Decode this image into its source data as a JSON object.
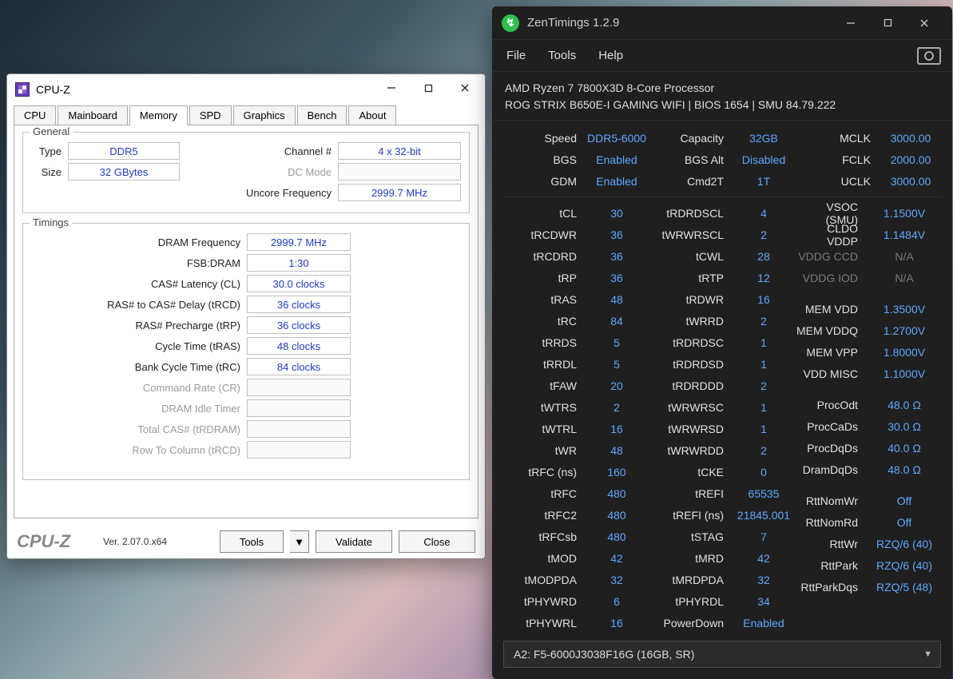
{
  "cpuz": {
    "title": "CPU-Z",
    "tabs": [
      "CPU",
      "Mainboard",
      "Memory",
      "SPD",
      "Graphics",
      "Bench",
      "About"
    ],
    "active_tab": "Memory",
    "general_legend": "General",
    "timings_legend": "Timings",
    "general": {
      "type_label": "Type",
      "type": "DDR5",
      "size_label": "Size",
      "size": "32 GBytes",
      "channel_label": "Channel #",
      "channel": "4 x 32-bit",
      "dcmode_label": "DC Mode",
      "dcmode": "",
      "uncore_label": "Uncore Frequency",
      "uncore": "2999.7 MHz"
    },
    "timings": [
      {
        "label": "DRAM Frequency",
        "value": "2999.7 MHz"
      },
      {
        "label": "FSB:DRAM",
        "value": "1:30"
      },
      {
        "label": "CAS# Latency (CL)",
        "value": "30.0 clocks"
      },
      {
        "label": "RAS# to CAS# Delay (tRCD)",
        "value": "36 clocks"
      },
      {
        "label": "RAS# Precharge (tRP)",
        "value": "36 clocks"
      },
      {
        "label": "Cycle Time (tRAS)",
        "value": "48 clocks"
      },
      {
        "label": "Bank Cycle Time (tRC)",
        "value": "84 clocks"
      },
      {
        "label": "Command Rate (CR)",
        "value": ""
      },
      {
        "label": "DRAM Idle Timer",
        "value": ""
      },
      {
        "label": "Total CAS# (tRDRAM)",
        "value": ""
      },
      {
        "label": "Row To Column (tRCD)",
        "value": ""
      }
    ],
    "footer": {
      "logo": "CPU-Z",
      "version": "Ver. 2.07.0.x64",
      "tools": "Tools",
      "validate": "Validate",
      "close": "Close"
    }
  },
  "zt": {
    "title": "ZenTimings 1.2.9",
    "menu": [
      "File",
      "Tools",
      "Help"
    ],
    "cpu": "AMD Ryzen 7 7800X3D 8-Core Processor",
    "board": "ROG STRIX B650E-I GAMING WIFI | BIOS 1654 | SMU 84.79.222",
    "top": {
      "col1": [
        {
          "k": "Speed",
          "v": "DDR5-6000"
        },
        {
          "k": "BGS",
          "v": "Enabled"
        },
        {
          "k": "GDM",
          "v": "Enabled"
        }
      ],
      "col2": [
        {
          "k": "Capacity",
          "v": "32GB"
        },
        {
          "k": "BGS Alt",
          "v": "Disabled"
        },
        {
          "k": "Cmd2T",
          "v": "1T"
        }
      ],
      "col3": [
        {
          "k": "MCLK",
          "v": "3000.00"
        },
        {
          "k": "FCLK",
          "v": "2000.00"
        },
        {
          "k": "UCLK",
          "v": "3000.00"
        }
      ]
    },
    "col1": [
      {
        "k": "tCL",
        "v": "30"
      },
      {
        "k": "tRCDWR",
        "v": "36"
      },
      {
        "k": "tRCDRD",
        "v": "36"
      },
      {
        "k": "tRP",
        "v": "36"
      },
      {
        "k": "tRAS",
        "v": "48"
      },
      {
        "k": "tRC",
        "v": "84"
      },
      {
        "k": "tRRDS",
        "v": "5"
      },
      {
        "k": "tRRDL",
        "v": "5"
      },
      {
        "k": "tFAW",
        "v": "20"
      },
      {
        "k": "tWTRS",
        "v": "2"
      },
      {
        "k": "tWTRL",
        "v": "16"
      },
      {
        "k": "tWR",
        "v": "48"
      },
      {
        "k": "tRFC (ns)",
        "v": "160"
      },
      {
        "k": "tRFC",
        "v": "480"
      },
      {
        "k": "tRFC2",
        "v": "480"
      },
      {
        "k": "tRFCsb",
        "v": "480"
      },
      {
        "k": "tMOD",
        "v": "42"
      },
      {
        "k": "tMODPDA",
        "v": "32"
      },
      {
        "k": "tPHYWRD",
        "v": "6"
      },
      {
        "k": "tPHYWRL",
        "v": "16"
      }
    ],
    "col2": [
      {
        "k": "tRDRDSCL",
        "v": "4"
      },
      {
        "k": "tWRWRSCL",
        "v": "2"
      },
      {
        "k": "tCWL",
        "v": "28"
      },
      {
        "k": "tRTP",
        "v": "12"
      },
      {
        "k": "tRDWR",
        "v": "16"
      },
      {
        "k": "tWRRD",
        "v": "2"
      },
      {
        "k": "tRDRDSC",
        "v": "1"
      },
      {
        "k": "tRDRDSD",
        "v": "1"
      },
      {
        "k": "tRDRDDD",
        "v": "2"
      },
      {
        "k": "tWRWRSC",
        "v": "1"
      },
      {
        "k": "tWRWRSD",
        "v": "1"
      },
      {
        "k": "tWRWRDD",
        "v": "2"
      },
      {
        "k": "tCKE",
        "v": "0"
      },
      {
        "k": "tREFI",
        "v": "65535"
      },
      {
        "k": "tREFI (ns)",
        "v": "21845.001"
      },
      {
        "k": "tSTAG",
        "v": "7"
      },
      {
        "k": "tMRD",
        "v": "42"
      },
      {
        "k": "tMRDPDA",
        "v": "32"
      },
      {
        "k": "tPHYRDL",
        "v": "34"
      },
      {
        "k": "PowerDown",
        "v": "Enabled"
      }
    ],
    "col3": [
      {
        "k": "VSOC (SMU)",
        "v": "1.1500V"
      },
      {
        "k": "CLDO VDDP",
        "v": "1.1484V"
      },
      {
        "k": "VDDG CCD",
        "v": "N/A",
        "gray": true
      },
      {
        "k": "VDDG IOD",
        "v": "N/A",
        "gray": true
      },
      {
        "gap": true
      },
      {
        "k": "MEM VDD",
        "v": "1.3500V"
      },
      {
        "k": "MEM VDDQ",
        "v": "1.2700V"
      },
      {
        "k": "MEM VPP",
        "v": "1.8000V"
      },
      {
        "k": "VDD MISC",
        "v": "1.1000V"
      },
      {
        "gap": true
      },
      {
        "k": "ProcOdt",
        "v": "48.0 Ω"
      },
      {
        "k": "ProcCaDs",
        "v": "30.0 Ω"
      },
      {
        "k": "ProcDqDs",
        "v": "40.0 Ω"
      },
      {
        "k": "DramDqDs",
        "v": "48.0 Ω"
      },
      {
        "gap": true
      },
      {
        "k": "RttNomWr",
        "v": "Off"
      },
      {
        "k": "RttNomRd",
        "v": "Off"
      },
      {
        "k": "RttWr",
        "v": "RZQ/6 (40)"
      },
      {
        "k": "RttPark",
        "v": "RZQ/6 (40)"
      },
      {
        "k": "RttParkDqs",
        "v": "RZQ/5 (48)"
      }
    ],
    "dropdown": "A2: F5-6000J3038F16G (16GB, SR)"
  }
}
